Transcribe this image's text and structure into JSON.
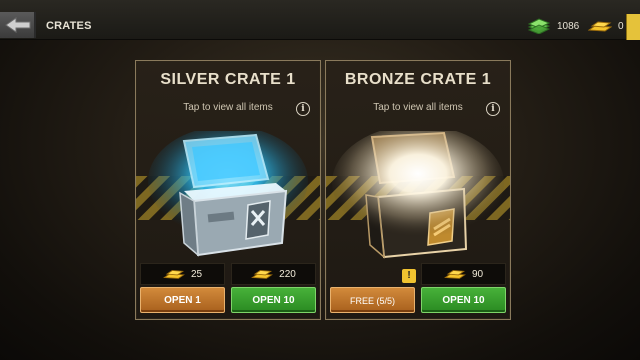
{
  "header": {
    "title": "CRATES",
    "currencies": [
      {
        "icon": "cash-stack-icon",
        "value": "1086"
      },
      {
        "icon": "gold-bars-icon",
        "value": "0"
      }
    ]
  },
  "crates": [
    {
      "name": "SILVER CRATE 1",
      "subtitle": "Tap to view all items",
      "info_label": "i",
      "prices": [
        "25",
        "220"
      ],
      "buttons": [
        "OPEN 1",
        "OPEN 10"
      ]
    },
    {
      "name": "BRONZE CRATE 1",
      "subtitle": "Tap to view all items",
      "info_label": "i",
      "alert_label": "!",
      "prices": [
        "",
        "90"
      ],
      "buttons": [
        "FREE (5/5)",
        "OPEN 10"
      ]
    }
  ],
  "colors": {
    "open_one_button": "#c17a2e",
    "open_ten_button": "#3a9e2f",
    "silver_glow": "#3fd1ff",
    "bronze_glow": "#ffffff",
    "gold": "#f2c23a"
  }
}
